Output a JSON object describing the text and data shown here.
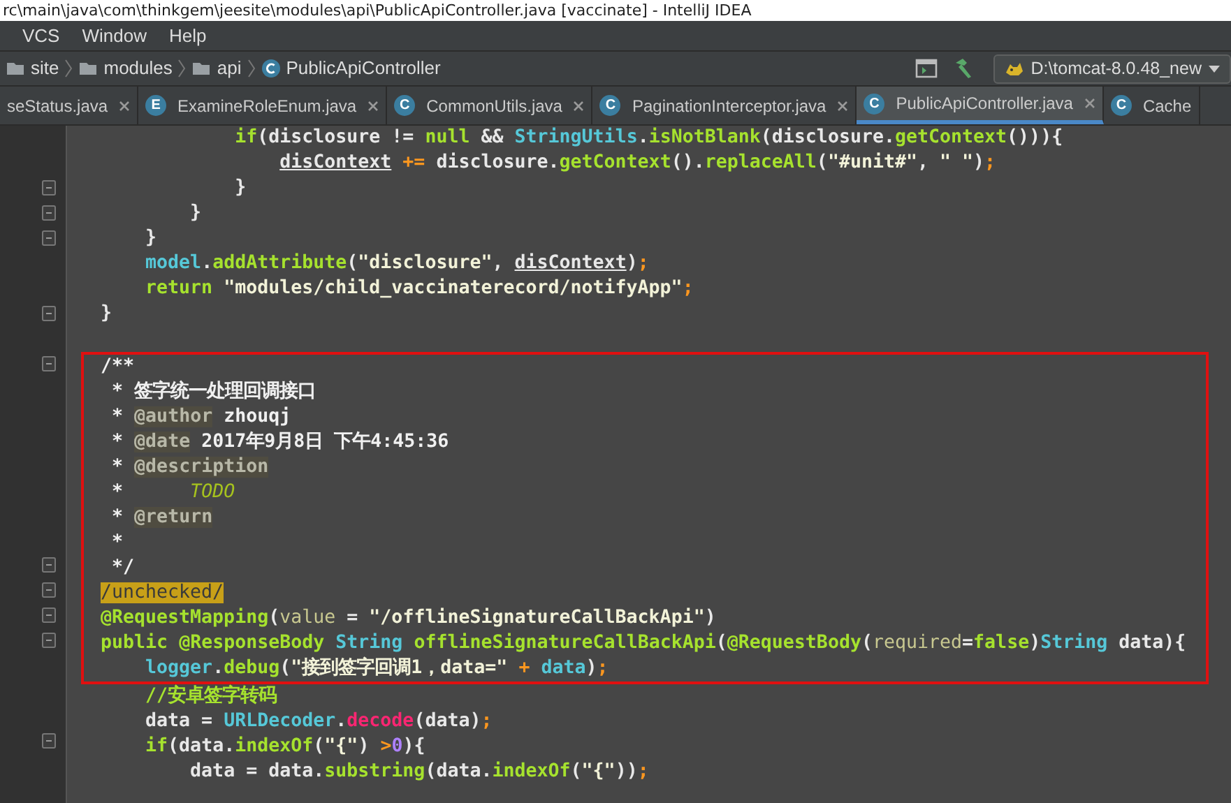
{
  "window": {
    "title": "rc\\main\\java\\com\\thinkgem\\jeesite\\modules\\api\\PublicApiController.java [vaccinate] - IntelliJ IDEA"
  },
  "menu": [
    "VCS",
    "Window",
    "Help"
  ],
  "breadcrumbs": [
    {
      "label": "site",
      "kind": "folder"
    },
    {
      "label": "modules",
      "kind": "folder"
    },
    {
      "label": "api",
      "kind": "folder"
    },
    {
      "label": "PublicApiController",
      "kind": "class"
    }
  ],
  "run_config": {
    "label": "D:\\tomcat-8.0.48_new"
  },
  "tabs": [
    {
      "label": "seStatus.java",
      "selected": false
    },
    {
      "label": "ExamineRoleEnum.java",
      "icon": "E",
      "selected": false
    },
    {
      "label": "CommonUtils.java",
      "icon": "C",
      "selected": false
    },
    {
      "label": "PaginationInterceptor.java",
      "icon": "C",
      "selected": false
    },
    {
      "label": "PublicApiController.java",
      "icon": "C",
      "selected": true
    },
    {
      "label": "Cache",
      "icon": "C",
      "selected": false
    }
  ],
  "code_lines": [
    {
      "kind": "code",
      "fold": false,
      "boxed": false,
      "tokens": [
        {
          "text": "            if",
          "kind": "kw"
        },
        {
          "text": "(disclosure != ",
          "kind": "plain"
        },
        {
          "text": "null",
          "kind": "kw"
        },
        {
          "text": " && ",
          "kind": "plain"
        },
        {
          "text": "StringUtils",
          "kind": "type"
        },
        {
          "text": ".",
          "kind": "plain"
        },
        {
          "text": "isNotBlank",
          "kind": "method"
        },
        {
          "text": "(disclosure.",
          "kind": "plain"
        },
        {
          "text": "getContext",
          "kind": "method"
        },
        {
          "text": "())){",
          "kind": "plain"
        }
      ]
    },
    {
      "kind": "code",
      "fold": false,
      "boxed": false,
      "tokens": [
        {
          "text": "                disContext",
          "kind": "field"
        },
        {
          "text": " +=",
          "kind": "op"
        },
        {
          "text": " disclosure.",
          "kind": "plain"
        },
        {
          "text": "getContext",
          "kind": "method"
        },
        {
          "text": "().",
          "kind": "plain"
        },
        {
          "text": "replaceAll",
          "kind": "method"
        },
        {
          "text": "(",
          "kind": "plain"
        },
        {
          "text": "\"#unit#\"",
          "kind": "str"
        },
        {
          "text": ", ",
          "kind": "plain"
        },
        {
          "text": "\" \"",
          "kind": "str"
        },
        {
          "text": ")",
          "kind": "plain"
        },
        {
          "text": ";",
          "kind": "op"
        }
      ]
    },
    {
      "kind": "code",
      "fold": true,
      "boxed": false,
      "tokens": [
        {
          "text": "            }",
          "kind": "plain"
        }
      ]
    },
    {
      "kind": "code",
      "fold": true,
      "boxed": false,
      "tokens": [
        {
          "text": "        }",
          "kind": "plain"
        }
      ]
    },
    {
      "kind": "code",
      "fold": true,
      "boxed": false,
      "tokens": [
        {
          "text": "    }",
          "kind": "plain"
        }
      ]
    },
    {
      "kind": "code",
      "fold": false,
      "boxed": false,
      "tokens": [
        {
          "text": "    model",
          "kind": "type"
        },
        {
          "text": ".",
          "kind": "plain"
        },
        {
          "text": "addAttribute",
          "kind": "method"
        },
        {
          "text": "(",
          "kind": "plain"
        },
        {
          "text": "\"disclosure\"",
          "kind": "str"
        },
        {
          "text": ", ",
          "kind": "plain"
        },
        {
          "text": "disContext",
          "kind": "field"
        },
        {
          "text": ")",
          "kind": "plain"
        },
        {
          "text": ";",
          "kind": "op"
        }
      ]
    },
    {
      "kind": "code",
      "fold": false,
      "boxed": false,
      "tokens": [
        {
          "text": "    return",
          "kind": "kw"
        },
        {
          "text": " \"modules/child_vaccinaterecord/notifyApp\"",
          "kind": "str"
        },
        {
          "text": ";",
          "kind": "op"
        }
      ]
    },
    {
      "kind": "code",
      "fold": true,
      "boxed": false,
      "tokens": [
        {
          "text": "}",
          "kind": "plain"
        }
      ]
    },
    {
      "kind": "blank"
    },
    {
      "kind": "code",
      "fold": true,
      "boxed": true,
      "tokens": [
        {
          "text": "/**",
          "kind": "doc"
        }
      ]
    },
    {
      "kind": "code",
      "fold": false,
      "boxed": true,
      "tokens": [
        {
          "text": " * 签字统一处理回调接口",
          "kind": "doc"
        }
      ]
    },
    {
      "kind": "code",
      "fold": false,
      "boxed": true,
      "tokens": [
        {
          "text": " *",
          "kind": "doc"
        },
        {
          "text": " @author",
          "kind": "tag"
        },
        {
          "text": " zhouqj",
          "kind": "doc"
        }
      ]
    },
    {
      "kind": "code",
      "fold": false,
      "boxed": true,
      "tokens": [
        {
          "text": " *",
          "kind": "doc"
        },
        {
          "text": " @date",
          "kind": "tag"
        },
        {
          "text": " 2017年9月8日 下午4:45:36",
          "kind": "doc"
        }
      ]
    },
    {
      "kind": "code",
      "fold": false,
      "boxed": true,
      "tokens": [
        {
          "text": " *",
          "kind": "doc"
        },
        {
          "text": " @description",
          "kind": "tag"
        }
      ]
    },
    {
      "kind": "code",
      "fold": false,
      "boxed": true,
      "tokens": [
        {
          "text": " *",
          "kind": "doc"
        },
        {
          "text": "      TODO",
          "kind": "todo"
        }
      ]
    },
    {
      "kind": "code",
      "fold": false,
      "boxed": true,
      "tokens": [
        {
          "text": " *",
          "kind": "doc"
        },
        {
          "text": " @return",
          "kind": "tag"
        }
      ]
    },
    {
      "kind": "code",
      "fold": false,
      "boxed": true,
      "tokens": [
        {
          "text": " *",
          "kind": "doc"
        }
      ]
    },
    {
      "kind": "code",
      "fold": true,
      "boxed": true,
      "tokens": [
        {
          "text": " */",
          "kind": "doc"
        }
      ]
    },
    {
      "kind": "code",
      "fold": true,
      "boxed": true,
      "tokens": [
        {
          "text": "/unchecked/",
          "kind": "mark"
        }
      ]
    },
    {
      "kind": "code",
      "fold": true,
      "boxed": true,
      "tokens": [
        {
          "text": "@RequestMapping",
          "kind": "ann"
        },
        {
          "text": "(",
          "kind": "plain"
        },
        {
          "text": "value",
          "kind": "param"
        },
        {
          "text": " = ",
          "kind": "plain"
        },
        {
          "text": "\"/offlineSignatureCallBackApi\"",
          "kind": "str"
        },
        {
          "text": ")",
          "kind": "plain"
        }
      ]
    },
    {
      "kind": "code",
      "fold": true,
      "boxed": true,
      "tokens": [
        {
          "text": "public",
          "kind": "kw"
        },
        {
          "text": " @ResponseBody",
          "kind": "ann"
        },
        {
          "text": " String",
          "kind": "type"
        },
        {
          "text": " offlineSignatureCallBackApi",
          "kind": "method"
        },
        {
          "text": "(",
          "kind": "plain"
        },
        {
          "text": "@RequestBody",
          "kind": "ann"
        },
        {
          "text": "(",
          "kind": "plain"
        },
        {
          "text": "required",
          "kind": "param"
        },
        {
          "text": "=",
          "kind": "plain"
        },
        {
          "text": "false",
          "kind": "kw"
        },
        {
          "text": ")",
          "kind": "plain"
        },
        {
          "text": "String",
          "kind": "type"
        },
        {
          "text": " data){",
          "kind": "plain"
        }
      ]
    },
    {
      "kind": "code",
      "fold": false,
      "boxed": true,
      "tokens": [
        {
          "text": "    logger",
          "kind": "type"
        },
        {
          "text": ".",
          "kind": "plain"
        },
        {
          "text": "debug",
          "kind": "method"
        },
        {
          "text": "(",
          "kind": "plain"
        },
        {
          "text": "\"接到签字回调1，data=\"",
          "kind": "str"
        },
        {
          "text": " +",
          "kind": "op"
        },
        {
          "text": " data",
          "kind": "type"
        },
        {
          "text": ")",
          "kind": "plain"
        },
        {
          "text": ";",
          "kind": "op"
        }
      ]
    },
    {
      "kind": "code",
      "fold": false,
      "boxed": false,
      "tokens": [
        {
          "text": "    //安卓签字转码",
          "kind": "comment"
        }
      ]
    },
    {
      "kind": "code",
      "fold": false,
      "boxed": false,
      "tokens": [
        {
          "text": "    data = ",
          "kind": "plain"
        },
        {
          "text": "URLDecoder",
          "kind": "type"
        },
        {
          "text": ".",
          "kind": "plain"
        },
        {
          "text": "decode",
          "kind": "red"
        },
        {
          "text": "(data)",
          "kind": "plain"
        },
        {
          "text": ";",
          "kind": "op"
        }
      ]
    },
    {
      "kind": "code",
      "fold": true,
      "boxed": false,
      "tokens": [
        {
          "text": "    if",
          "kind": "kw"
        },
        {
          "text": "(data.",
          "kind": "plain"
        },
        {
          "text": "indexOf",
          "kind": "method"
        },
        {
          "text": "(",
          "kind": "plain"
        },
        {
          "text": "\"{\"",
          "kind": "str"
        },
        {
          "text": ") ",
          "kind": "plain"
        },
        {
          "text": ">",
          "kind": "op"
        },
        {
          "text": "0",
          "kind": "num"
        },
        {
          "text": "){",
          "kind": "plain"
        }
      ]
    },
    {
      "kind": "code",
      "fold": false,
      "boxed": false,
      "tokens": [
        {
          "text": "        data = data.",
          "kind": "plain"
        },
        {
          "text": "substring",
          "kind": "method"
        },
        {
          "text": "(data.",
          "kind": "plain"
        },
        {
          "text": "indexOf",
          "kind": "method"
        },
        {
          "text": "(",
          "kind": "plain"
        },
        {
          "text": "\"{\"",
          "kind": "str"
        },
        {
          "text": "))",
          "kind": "plain"
        },
        {
          "text": ";",
          "kind": "op"
        }
      ]
    }
  ]
}
